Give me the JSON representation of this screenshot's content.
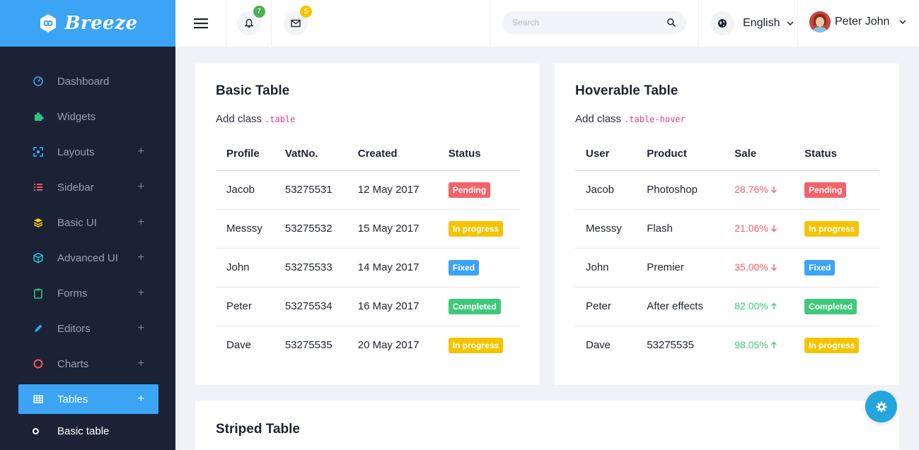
{
  "brand": {
    "name": "Breeze"
  },
  "sidebar": {
    "items": [
      {
        "label": "Dashboard",
        "icon": "dashboard-icon",
        "color": "#3ba4f4",
        "expandable": false
      },
      {
        "label": "Widgets",
        "icon": "puzzle-icon",
        "color": "#2ec27e",
        "expandable": false
      },
      {
        "label": "Layouts",
        "icon": "expand-icon",
        "color": "#3ba4f4",
        "expandable": true
      },
      {
        "label": "Sidebar",
        "icon": "list-icon",
        "color": "#f0555a",
        "expandable": true
      },
      {
        "label": "Basic UI",
        "icon": "layers-icon",
        "color": "#f5c400",
        "expandable": true
      },
      {
        "label": "Advanced UI",
        "icon": "cube-icon",
        "color": "#2fc0d8",
        "expandable": true
      },
      {
        "label": "Forms",
        "icon": "clipboard-icon",
        "color": "#2ec27e",
        "expandable": true
      },
      {
        "label": "Editors",
        "icon": "pencil-icon",
        "color": "#3ba4f4",
        "expandable": true
      },
      {
        "label": "Charts",
        "icon": "circle-icon",
        "color": "#f0555a",
        "expandable": true
      },
      {
        "label": "Tables",
        "icon": "table-icon",
        "color": "#ffffff",
        "expandable": true,
        "active": true
      }
    ],
    "plus": "+",
    "submenu": [
      {
        "label": "Basic table"
      }
    ]
  },
  "topbar": {
    "notifications": {
      "count": "7",
      "color": "#4caf50"
    },
    "messages": {
      "count": "5",
      "color": "#f5c400"
    },
    "search": {
      "placeholder": "Search"
    },
    "language": "English",
    "user": "Peter John"
  },
  "basic_table": {
    "title": "Basic Table",
    "sub_text": "Add class",
    "sub_code": ".table",
    "headers": [
      "Profile",
      "VatNo.",
      "Created",
      "Status"
    ],
    "rows": [
      {
        "profile": "Jacob",
        "vat": "53275531",
        "created": "12 May 2017",
        "status": "Pending",
        "status_color": "#f5626a"
      },
      {
        "profile": "Messsy",
        "vat": "53275532",
        "created": "15 May 2017",
        "status": "In progress",
        "status_color": "#f5c400"
      },
      {
        "profile": "John",
        "vat": "53275533",
        "created": "14 May 2017",
        "status": "Fixed",
        "status_color": "#3ba4f4"
      },
      {
        "profile": "Peter",
        "vat": "53275534",
        "created": "16 May 2017",
        "status": "Completed",
        "status_color": "#3ec97a"
      },
      {
        "profile": "Dave",
        "vat": "53275535",
        "created": "20 May 2017",
        "status": "In progress",
        "status_color": "#f5c400"
      }
    ]
  },
  "hover_table": {
    "title": "Hoverable Table",
    "sub_text": "Add class",
    "sub_code": ".table-hover",
    "headers": [
      "User",
      "Product",
      "Sale",
      "Status"
    ],
    "rows": [
      {
        "user": "Jacob",
        "product": "Photoshop",
        "sale": "28.76%",
        "trend": "down",
        "status": "Pending",
        "status_color": "#f5626a"
      },
      {
        "user": "Messsy",
        "product": "Flash",
        "sale": "21.06%",
        "trend": "down",
        "status": "In progress",
        "status_color": "#f5c400"
      },
      {
        "user": "John",
        "product": "Premier",
        "sale": "35.00%",
        "trend": "down",
        "status": "Fixed",
        "status_color": "#3ba4f4"
      },
      {
        "user": "Peter",
        "product": "After effects",
        "sale": "82.00%",
        "trend": "up",
        "status": "Completed",
        "status_color": "#3ec97a"
      },
      {
        "user": "Dave",
        "product": "53275535",
        "sale": "98.05%",
        "trend": "up",
        "status": "In progress",
        "status_color": "#f5c400"
      }
    ],
    "down_color": "#f5626a",
    "up_color": "#3ec97a"
  },
  "striped_table": {
    "title": "Striped Table"
  }
}
